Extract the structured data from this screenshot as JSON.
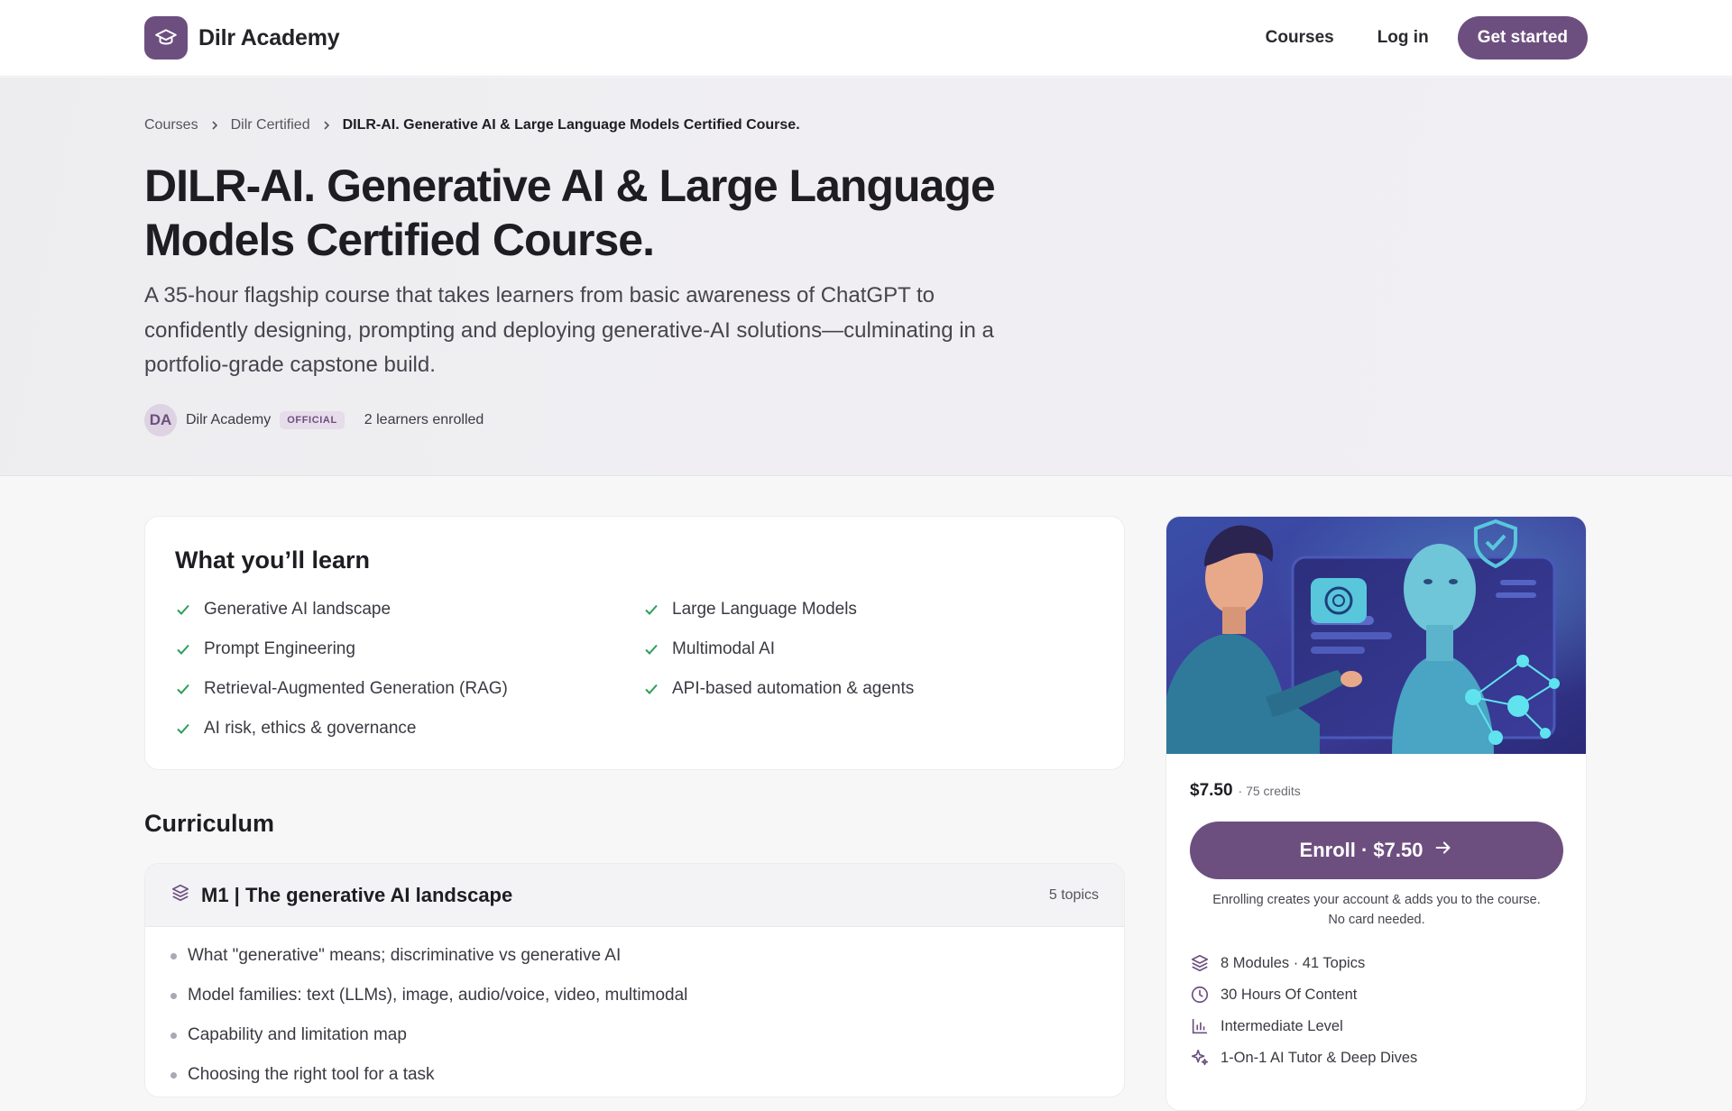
{
  "header": {
    "brand_name": "Dilr Academy",
    "nav": {
      "courses": "Courses",
      "login": "Log in",
      "get_started": "Get started"
    }
  },
  "hero": {
    "breadcrumb": [
      "Courses",
      "Dilr Certified",
      "DILR-AI. Generative AI & Large Language Models Certified Course."
    ],
    "title_line1": "DILR-AI. Generative AI & Large Language",
    "title_line2": "Models Certified Course.",
    "description_line1": "A 35-hour flagship course that takes learners from basic awareness of ChatGPT to",
    "description_line2": "confidently designing, prompting and deploying generative-AI solutions—culminating in a",
    "description_line3": "portfolio-grade capstone build.",
    "author_initials": "DA",
    "author_name": "Dilr Academy",
    "author_badge": "OFFICIAL",
    "enrolled": "2 learners enrolled"
  },
  "learn": {
    "title": "What you’ll learn",
    "items": [
      "Generative AI landscape",
      "Large Language Models",
      "Prompt Engineering",
      "Multimodal AI",
      "Retrieval-Augmented Generation (RAG)",
      "API-based automation & agents",
      "AI risk, ethics & governance"
    ]
  },
  "curriculum": {
    "title": "Curriculum",
    "module": {
      "title": "M1 | The generative AI landscape",
      "count": "5 topics",
      "topics": [
        "What \"generative\" means; discriminative vs generative AI",
        "Model families: text (LLMs), image, audio/voice, video, multimodal",
        "Capability and limitation map",
        "Choosing the right tool for a task"
      ]
    }
  },
  "sidebar": {
    "price": "$7.50",
    "credits": "· 75 credits",
    "enroll_label": "Enroll · $7.50",
    "note_line1": "Enrolling creates your account & adds you to the course.",
    "note_line2": "No card needed.",
    "features": [
      "8 Modules · 41 Topics",
      "30 Hours Of Content",
      "Intermediate Level",
      "1-On-1 AI Tutor & Deep Dives"
    ]
  },
  "colors": {
    "brand": "#6d4f7f",
    "check": "#2e9e5b"
  }
}
